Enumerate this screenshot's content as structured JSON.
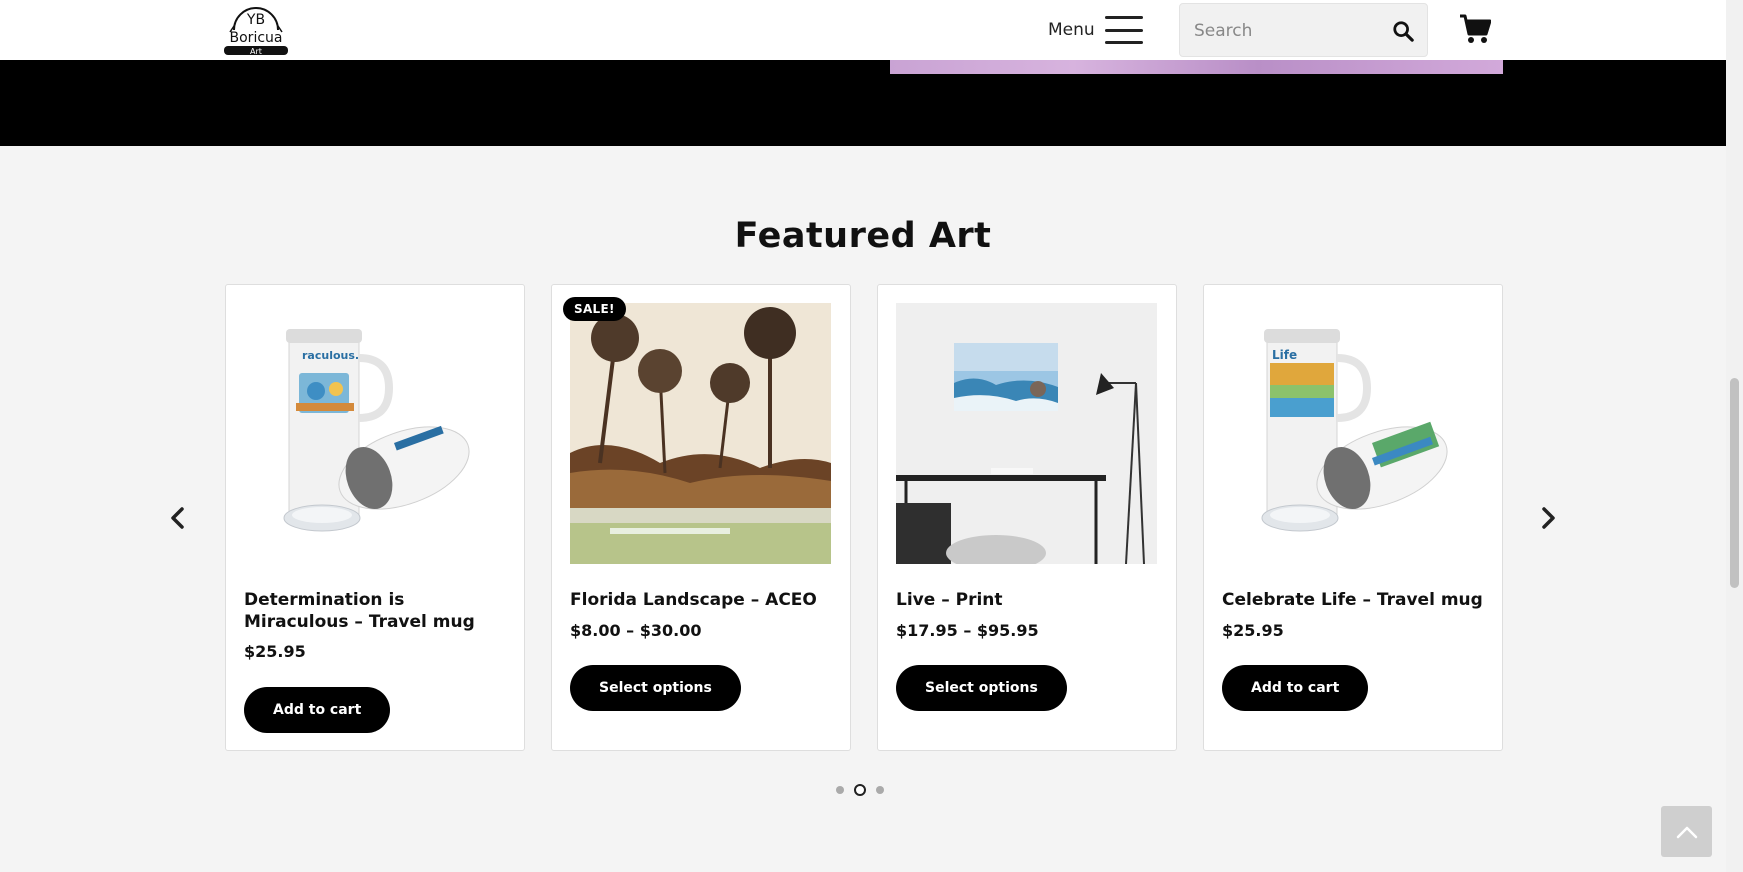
{
  "header": {
    "logo": {
      "line1": "YB",
      "line2": "Boricua",
      "line3": "Art"
    },
    "menu_label": "Menu",
    "search_placeholder": "Search",
    "icons": [
      "hamburger-icon",
      "search-icon",
      "cart-icon"
    ]
  },
  "section": {
    "title": "Featured Art"
  },
  "products": [
    {
      "title": "Determination is Miraculous – Travel mug",
      "price": "$25.95",
      "button": "Add to cart",
      "badge": ""
    },
    {
      "title": "Florida Landscape – ACEO",
      "price": "$8.00 – $30.00",
      "button": "Select options",
      "badge": "SALE!"
    },
    {
      "title": "Live – Print",
      "price": "$17.95 – $95.95",
      "button": "Select options",
      "badge": ""
    },
    {
      "title": "Celebrate Life – Travel mug",
      "price": "$25.95",
      "button": "Add to cart",
      "badge": ""
    }
  ],
  "carousel": {
    "dot_count": 3,
    "active_dot": 2,
    "icons": [
      "chevron-left-icon",
      "chevron-right-icon"
    ]
  },
  "back_to_top_icon": "chevron-up-icon",
  "colors": {
    "page_bg": "#f4f4f4",
    "button_bg": "#000000",
    "banner_bg": "#000000",
    "accent_text": "#111111"
  }
}
